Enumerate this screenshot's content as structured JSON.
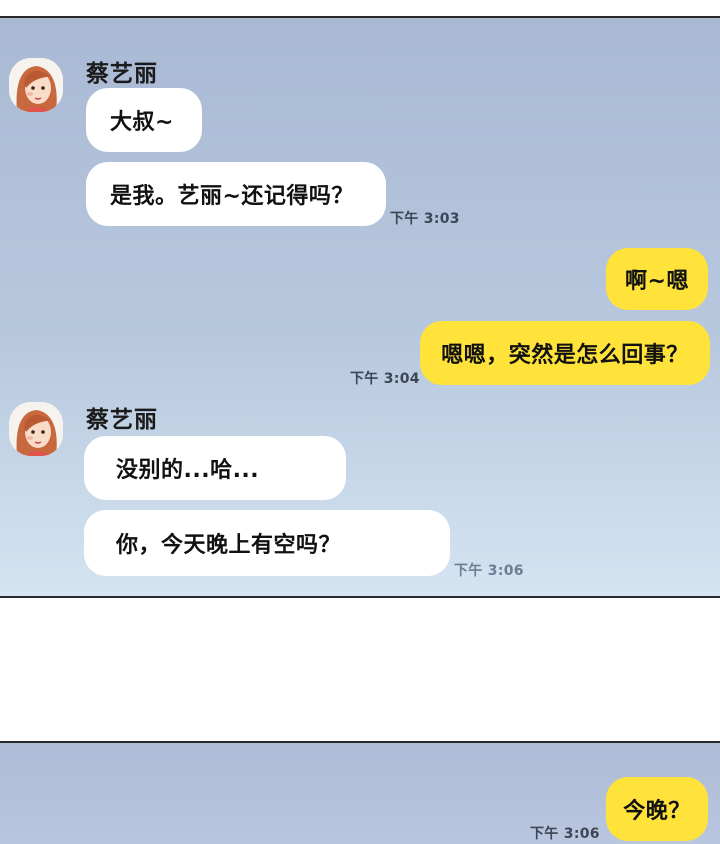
{
  "colors": {
    "chat_background": "#b7c8de",
    "incoming_bubble": "#ffffff",
    "outgoing_bubble": "#ffe23a",
    "timestamp_text": "#3c4656"
  },
  "panel1": {
    "group1": {
      "sender": "蔡艺丽",
      "avatar": "woman-avatar-icon",
      "messages": [
        "大叔~",
        "是我。艺丽~还记得吗？"
      ],
      "time": "下午 3:03"
    },
    "group2": {
      "messages": [
        "啊~嗯",
        "嗯嗯，突然是怎么回事？"
      ],
      "time": "下午 3:04"
    },
    "group3": {
      "sender": "蔡艺丽",
      "avatar": "woman-avatar-icon",
      "messages": [
        "没别的...哈...",
        "你，今天晚上有空吗？"
      ],
      "time": "下午 3:06"
    }
  },
  "panel2": {
    "group1": {
      "messages": [
        "今晚？"
      ],
      "time": "下午 3:06"
    }
  }
}
